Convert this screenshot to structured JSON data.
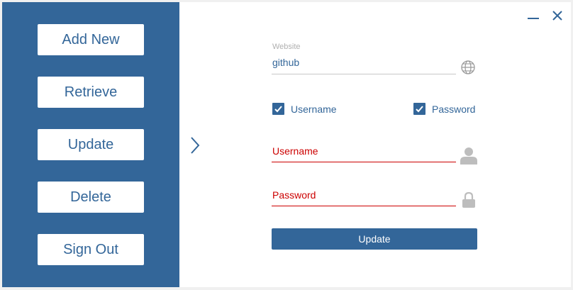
{
  "sidebar": {
    "buttons": [
      {
        "label": "Add New"
      },
      {
        "label": "Retrieve"
      },
      {
        "label": "Update"
      },
      {
        "label": "Delete"
      },
      {
        "label": "Sign Out"
      }
    ]
  },
  "window_controls": {
    "minimize_icon": "minimize-icon",
    "close_icon": "close-icon"
  },
  "form": {
    "website": {
      "label": "Website",
      "value": "github",
      "icon": "globe-icon"
    },
    "checkboxes": [
      {
        "label": "Username",
        "checked": true
      },
      {
        "label": "Password",
        "checked": true
      }
    ],
    "username": {
      "placeholder": "Username",
      "icon": "user-icon"
    },
    "password": {
      "placeholder": "Password",
      "icon": "lock-icon"
    },
    "submit_label": "Update"
  },
  "colors": {
    "accent": "#336699",
    "error": "#cc0000",
    "muted": "#b0b0b0"
  }
}
